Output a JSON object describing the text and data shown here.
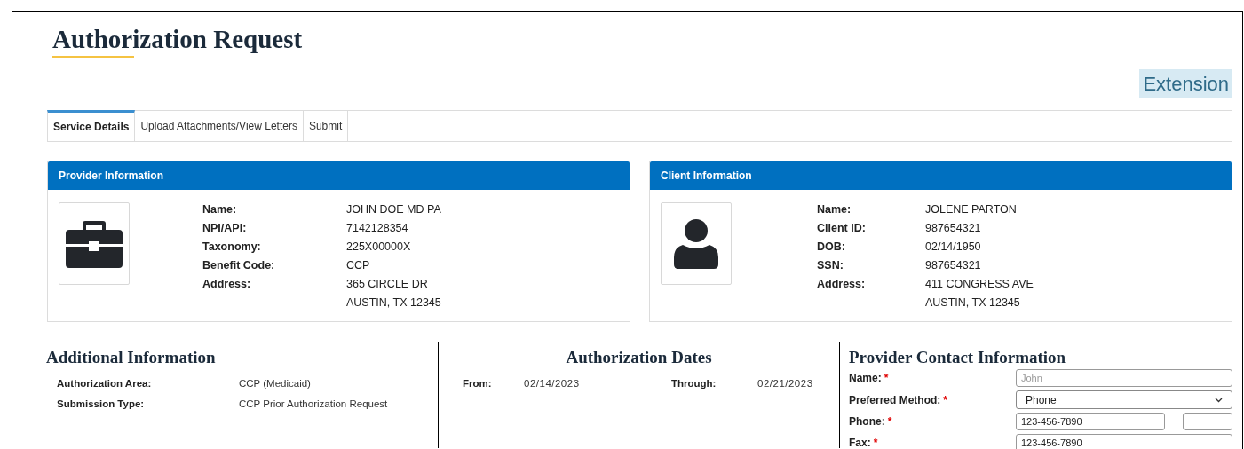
{
  "title": "Authorization Request",
  "badge": "Extension",
  "tabs": [
    {
      "label": "Service Details",
      "selected": true
    },
    {
      "label": "Upload Attachments/View Letters",
      "selected": false
    },
    {
      "label": "Submit",
      "selected": false
    }
  ],
  "panels": [
    {
      "title": "Provider Information",
      "kind": "provider",
      "fields": [
        {
          "label": "Name:",
          "lines": [
            "JOHN DOE MD PA"
          ]
        },
        {
          "label": "NPI/API:",
          "lines": [
            "7142128354"
          ]
        },
        {
          "label": "Taxonomy:",
          "lines": [
            "225X00000X"
          ]
        },
        {
          "label": "Benefit Code:",
          "lines": [
            "CCP"
          ]
        },
        {
          "label": "Address:",
          "lines": [
            "365 CIRCLE DR",
            "AUSTIN, TX 12345"
          ]
        }
      ]
    },
    {
      "title": "Client Information",
      "kind": "client",
      "fields": [
        {
          "label": "Name:",
          "lines": [
            "JOLENE PARTON"
          ]
        },
        {
          "label": "Client ID:",
          "lines": [
            "987654321"
          ]
        },
        {
          "label": "DOB:",
          "lines": [
            "02/14/1950"
          ]
        },
        {
          "label": "SSN:",
          "lines": [
            "987654321"
          ]
        },
        {
          "label": "Address:",
          "lines": [
            "411 CONGRESS AVE",
            "AUSTIN, TX 12345"
          ]
        }
      ]
    }
  ],
  "additional": {
    "title": "Additional Information",
    "fields": [
      {
        "label": "Authorization Area:",
        "value": "CCP (Medicaid)"
      },
      {
        "label": "Submission Type:",
        "value": "CCP Prior Authorization Request"
      }
    ]
  },
  "dates": {
    "title": "Authorization Dates",
    "fields": [
      {
        "label": "From:",
        "value": "02/14/2023"
      },
      {
        "label": "Through:",
        "value": "02/21/2023"
      }
    ]
  },
  "contact": {
    "title": "Provider Contact Information",
    "fields": [
      {
        "label": "Name:",
        "required_mark": "*",
        "kind": "text",
        "placeholder": "John"
      },
      {
        "label": "Preferred Method:",
        "required_mark": "*",
        "kind": "select",
        "value": "Phone"
      },
      {
        "label": "Phone:",
        "required_mark": "*",
        "kind": "phone",
        "value": "123-456-7890"
      },
      {
        "label": "Fax:",
        "required_mark": "*",
        "kind": "text",
        "value": "123-456-7890"
      }
    ]
  }
}
